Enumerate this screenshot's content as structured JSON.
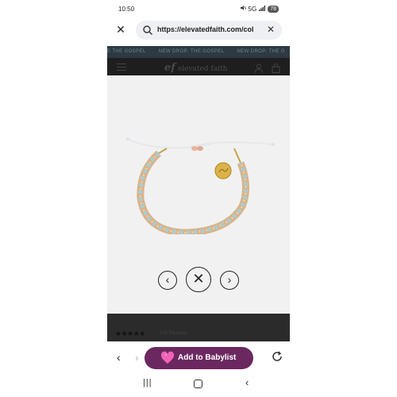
{
  "status_bar": {
    "time": "10:50",
    "network": "5G",
    "battery": "78"
  },
  "browser": {
    "url": "https://elevatedfaith.com/col",
    "clear_glyph": "✕",
    "close_tab_glyph": "✕"
  },
  "site": {
    "promo_items": [
      "E THE GOSPEL",
      "NEW DROP: THE GOSPEL",
      "NEW DROP: THE G"
    ],
    "logo_mark": "ef",
    "logo_text": "elevated faith"
  },
  "gallery": {
    "prev_glyph": "‹",
    "close_glyph": "✕",
    "next_glyph": "›"
  },
  "reviews": {
    "stars": "★★★★★",
    "count_text": "159 Reviews"
  },
  "bottom_bar": {
    "back_glyph": "‹",
    "forward_glyph": "›",
    "babylist_label": "Add to Babylist"
  },
  "system_nav": {
    "recents_glyph": "|||",
    "back_glyph": "‹"
  },
  "colors": {
    "babylist_purple": "#6b2860",
    "header_dark": "#1e1e1e",
    "promo_bar": "#2d3a42"
  }
}
